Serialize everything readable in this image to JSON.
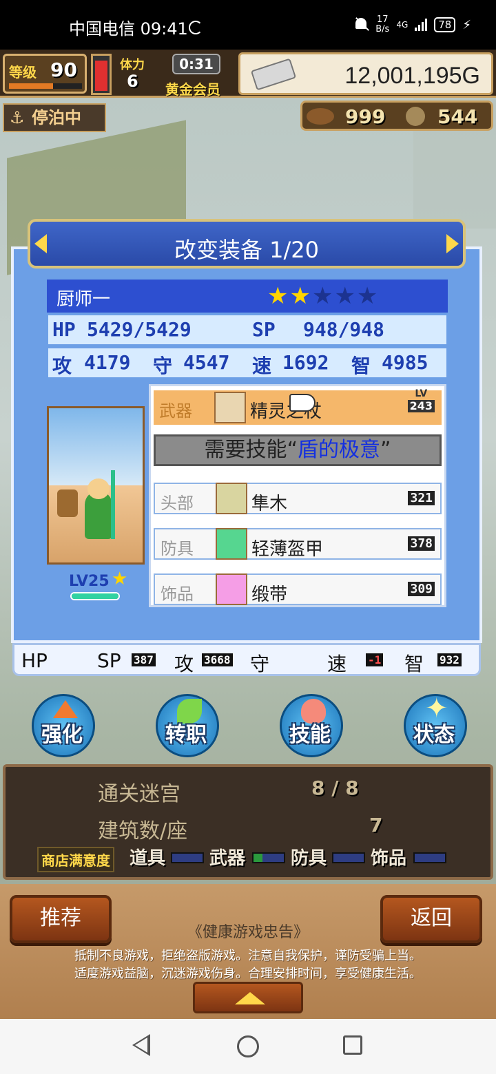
{
  "status_bar": {
    "carrier_time": "中国电信 09:41",
    "speed_value": "17",
    "speed_unit": "B/s",
    "network": "4G",
    "battery": "78"
  },
  "hud": {
    "level_label": "等级",
    "level_value": "90",
    "clock_label": "体力",
    "clock_value": "6",
    "timer": "0:31",
    "member_label": "黄金会员",
    "gold": "12,001,195G",
    "dock_status": "停泊中",
    "res1": "999",
    "res2": "544"
  },
  "dialog": {
    "title": "改变装备 1/20",
    "char_name": "厨师一",
    "stars_on": "★★",
    "stars_off": "★★★",
    "hp_label": "HP",
    "hp_value": "5429/5429",
    "sp_label": "SP",
    "sp_value": "948/948",
    "atk_label": "攻",
    "atk_value": "4179",
    "def_label": "守",
    "def_value": "4547",
    "spd_label": "速",
    "spd_value": "1692",
    "int_label": "智",
    "int_value": "4985",
    "char_level": "LV25"
  },
  "equipment": {
    "weapon": {
      "slot": "武器",
      "name": "精灵之杖",
      "lv_label": "LV",
      "lv_value": "243"
    },
    "skill_prefix": "需要技能“",
    "skill_name": "盾的极意",
    "skill_suffix": "”",
    "head": {
      "slot": "头部",
      "name": "隼木",
      "value": "321"
    },
    "armor": {
      "slot": "防具",
      "name": "轻薄盔甲",
      "value": "378"
    },
    "accessory": {
      "slot": "饰品",
      "name": "缎带",
      "value": "309"
    }
  },
  "bottom_stats": {
    "hp_label": "HP",
    "sp_label": "SP",
    "sp_value": "387",
    "atk_label": "攻",
    "atk_value": "3668",
    "def_label": "守",
    "spd_label": "速",
    "spd_value": "-1",
    "int_label": "智",
    "int_value": "932"
  },
  "actions": [
    {
      "label": "强化",
      "icon": "up-arrow-icon"
    },
    {
      "label": "转职",
      "icon": "leaf-icon"
    },
    {
      "label": "技能",
      "icon": "flame-icon"
    },
    {
      "label": "状态",
      "icon": "sparkle-icon"
    }
  ],
  "info": {
    "dungeon_label": "通关迷宫",
    "dungeon_value": "8 / 8",
    "building_label": "建筑数/座",
    "building_value": "7",
    "satisfaction_label": "商店满意度",
    "sat_items": [
      "道具",
      "武器",
      "防具",
      "饰品"
    ]
  },
  "footer": {
    "recommend": "推荐",
    "back": "返回",
    "notice_title": "《健康游戏忠告》",
    "notice_line1": "抵制不良游戏，拒绝盗版游戏。注意自我保护，谨防受骗上当。",
    "notice_line2": "适度游戏益脑，沉迷游戏伤身。合理安排时间，享受健康生活。"
  },
  "colors": {
    "dialog_blue": "#6c9fe6",
    "title_blue": "#2a4aa8",
    "weapon_row": "#f5b76a",
    "skill_blue": "#1430e0",
    "wood": "#b07f4e"
  }
}
